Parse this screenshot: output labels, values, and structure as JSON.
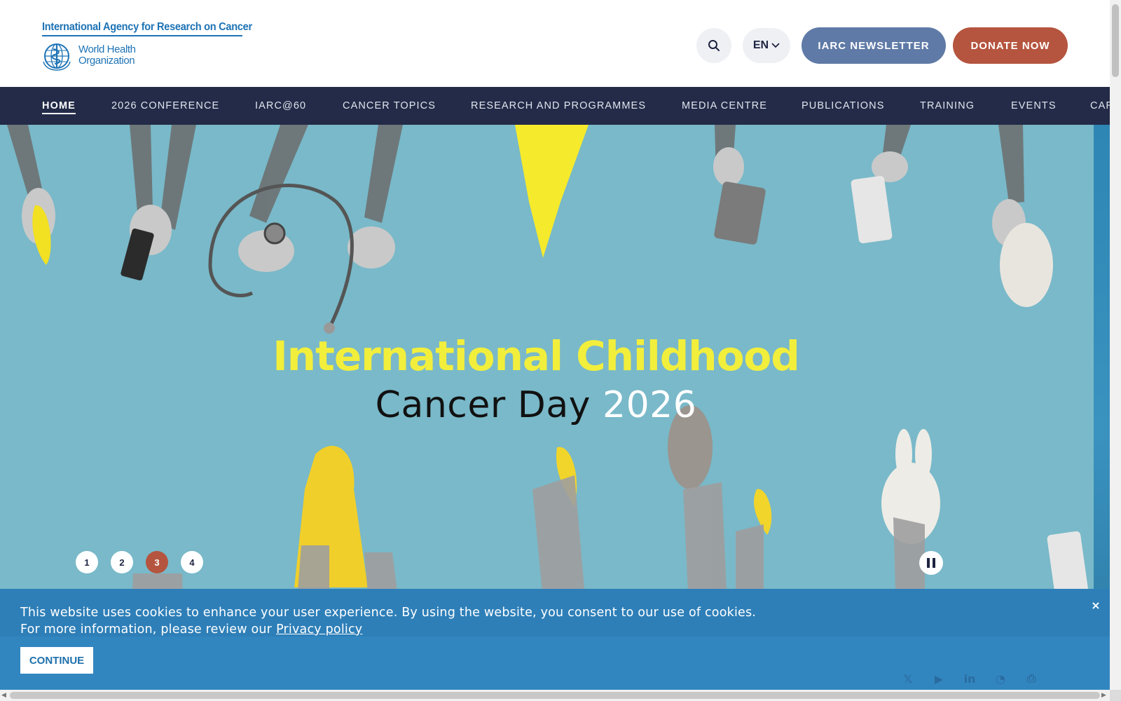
{
  "header": {
    "agency_name": "International Agency for Research on Cancer",
    "who_line1": "World Health",
    "who_line2": "Organization",
    "language": "EN",
    "newsletter_label": "IARC NEWSLETTER",
    "donate_label": "DONATE NOW"
  },
  "nav": {
    "items": [
      {
        "label": "HOME",
        "active": true
      },
      {
        "label": "2026 CONFERENCE"
      },
      {
        "label": "IARC@60"
      },
      {
        "label": "CANCER TOPICS"
      },
      {
        "label": "RESEARCH AND PROGRAMMES"
      },
      {
        "label": "MEDIA CENTRE"
      },
      {
        "label": "PUBLICATIONS"
      },
      {
        "label": "TRAINING"
      },
      {
        "label": "EVENTS"
      },
      {
        "label": "CAREERS"
      }
    ]
  },
  "hero": {
    "title_line1": "International Childhood",
    "title_line2": "Cancer Day",
    "title_year": "2026",
    "slides": [
      "1",
      "2",
      "3",
      "4"
    ],
    "active_slide": "3"
  },
  "cookie": {
    "line1": "This website uses cookies to enhance your user experience. By using the website, you consent to our use of cookies.",
    "line2": "For more information, please review our",
    "link": "Privacy policy",
    "continue_label": "CONTINUE",
    "close_label": "×"
  },
  "colors": {
    "brand_blue": "#1e73b5",
    "nav_bg": "#232b48",
    "newsletter": "#5f7aa6",
    "donate": "#b5553f",
    "hero_bg": "#79b9c9",
    "hero_yellow": "#f2ee3c",
    "cookie_bg": "#2e7fb8"
  },
  "icons": {
    "search": "search-icon",
    "chevron": "chevron-down-icon",
    "pause": "pause-icon",
    "social": [
      "x-icon",
      "youtube-icon",
      "linkedin-icon",
      "rss-icon",
      "print-icon"
    ]
  }
}
